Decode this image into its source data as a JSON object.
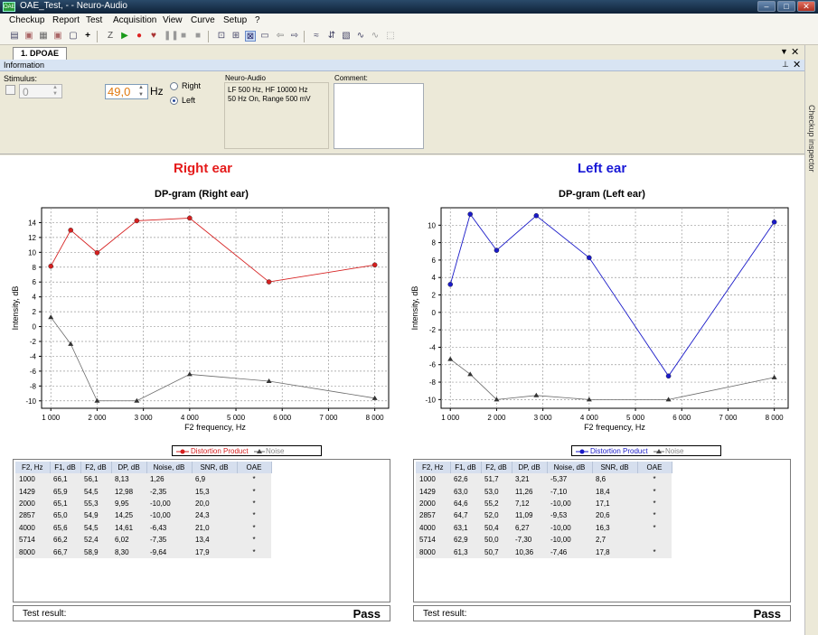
{
  "window": {
    "title": "OAE_Test, - - Neuro-Audio",
    "icon_text": "OAE"
  },
  "menu": [
    "Checkup",
    "Report",
    "Test",
    "Acquisition",
    "View",
    "Curve",
    "Setup",
    "?"
  ],
  "doc_tab": {
    "label": "1. DPOAE"
  },
  "info": {
    "header": "Information",
    "stimulus_label": "Stimulus:",
    "stimulus_value": "0",
    "freq_value": "49,0",
    "freq_unit": "Hz",
    "radio_right": "Right",
    "radio_left": "Left",
    "selected_radio": "Left",
    "device_label": "Neuro-Audio",
    "device_line1": "LF  500 Hz, HF  10000 Hz",
    "device_line2": "50 Hz  On, Range 500 mV",
    "comment_label": "Comment:",
    "comment_value": ""
  },
  "sidebar_label": "Checkup inspector",
  "colors": {
    "right_dp": "#d62020",
    "left_dp": "#1a1ac8",
    "noise": "#6a6a6a",
    "right_title": "#e51b1b",
    "left_title": "#1818d6"
  },
  "right": {
    "ear_title": "Right ear",
    "legend_dp": "Distortion Product",
    "legend_noise": "Noise",
    "result_label": "Test result:",
    "result_value": "Pass",
    "columns": [
      "F2, Hz",
      "F1, dB",
      "F2, dB",
      "DP, dB",
      "Noise, dB",
      "SNR, dB",
      "OAE"
    ],
    "rows": [
      [
        "1000",
        "66,1",
        "56,1",
        "8,13",
        "1,26",
        "6,9",
        "*"
      ],
      [
        "1429",
        "65,9",
        "54,5",
        "12,98",
        "-2,35",
        "15,3",
        "*"
      ],
      [
        "2000",
        "65,1",
        "55,3",
        "9,95",
        "-10,00",
        "20,0",
        "*"
      ],
      [
        "2857",
        "65,0",
        "54,9",
        "14,25",
        "-10,00",
        "24,3",
        "*"
      ],
      [
        "4000",
        "65,6",
        "54,5",
        "14,61",
        "-6,43",
        "21,0",
        "*"
      ],
      [
        "5714",
        "66,2",
        "52,4",
        "6,02",
        "-7,35",
        "13,4",
        "*"
      ],
      [
        "8000",
        "66,7",
        "58,9",
        "8,30",
        "-9,64",
        "17,9",
        "*"
      ]
    ]
  },
  "left": {
    "ear_title": "Left ear",
    "legend_dp": "Distortion Product",
    "legend_noise": "Noise",
    "result_label": "Test result:",
    "result_value": "Pass",
    "columns": [
      "F2, Hz",
      "F1, dB",
      "F2, dB",
      "DP, dB",
      "Noise, dB",
      "SNR, dB",
      "OAE"
    ],
    "rows": [
      [
        "1000",
        "62,6",
        "51,7",
        "3,21",
        "-5,37",
        "8,6",
        "*"
      ],
      [
        "1429",
        "63,0",
        "53,0",
        "11,26",
        "-7,10",
        "18,4",
        "*"
      ],
      [
        "2000",
        "64,6",
        "55,2",
        "7,12",
        "-10,00",
        "17,1",
        "*"
      ],
      [
        "2857",
        "64,7",
        "52,0",
        "11,09",
        "-9,53",
        "20,6",
        "*"
      ],
      [
        "4000",
        "63,1",
        "50,4",
        "6,27",
        "-10,00",
        "16,3",
        "*"
      ],
      [
        "5714",
        "62,9",
        "50,0",
        "-7,30",
        "-10,00",
        "2,7",
        ""
      ],
      [
        "8000",
        "61,3",
        "50,7",
        "10,36",
        "-7,46",
        "17,8",
        "*"
      ]
    ]
  },
  "chart_data": [
    {
      "type": "line",
      "title": "DP-gram (Right ear)",
      "xlabel": "F2 frequency, Hz",
      "ylabel": "Intensity, dB",
      "xlim": [
        800,
        8300
      ],
      "ylim": [
        -11,
        16
      ],
      "xticks": [
        1000,
        2000,
        3000,
        4000,
        5000,
        6000,
        7000,
        8000
      ],
      "xtick_labels": [
        "1 000",
        "2 000",
        "3 000",
        "4 000",
        "5 000",
        "6 000",
        "7 000",
        "8 000"
      ],
      "yticks": [
        -10,
        -8,
        -6,
        -4,
        -2,
        0,
        2,
        4,
        6,
        8,
        10,
        12,
        14
      ],
      "ytick_labels": [
        "-10",
        "-8",
        "-6",
        "-4",
        "-2",
        "0",
        "2",
        "4",
        "6",
        "8",
        "10",
        "12",
        "14"
      ],
      "grid": true,
      "legend": "bottom",
      "series": [
        {
          "name": "Distortion Product",
          "x": [
            1000,
            1429,
            2000,
            2857,
            4000,
            5714,
            8000
          ],
          "y": [
            8.13,
            12.98,
            9.95,
            14.25,
            14.61,
            6.02,
            8.3
          ]
        },
        {
          "name": "Noise",
          "x": [
            1000,
            1429,
            2000,
            2857,
            4000,
            5714,
            8000
          ],
          "y": [
            1.26,
            -2.35,
            -10.0,
            -10.0,
            -6.43,
            -7.35,
            -9.64
          ]
        }
      ]
    },
    {
      "type": "line",
      "title": "DP-gram (Left ear)",
      "xlabel": "F2 frequency, Hz",
      "ylabel": "Intensity, dB",
      "xlim": [
        800,
        8300
      ],
      "ylim": [
        -11,
        12
      ],
      "xticks": [
        1000,
        2000,
        3000,
        4000,
        5000,
        6000,
        7000,
        8000
      ],
      "xtick_labels": [
        "1 000",
        "2 000",
        "3 000",
        "4 000",
        "5 000",
        "6 000",
        "7 000",
        "8 000"
      ],
      "yticks": [
        -10,
        -8,
        -6,
        -4,
        -2,
        0,
        2,
        4,
        6,
        8,
        10
      ],
      "ytick_labels": [
        "-10",
        "-8",
        "-6",
        "-4",
        "-2",
        "0",
        "2",
        "4",
        "6",
        "8",
        "10"
      ],
      "grid": true,
      "legend": "bottom",
      "series": [
        {
          "name": "Distortion Product",
          "x": [
            1000,
            1429,
            2000,
            2857,
            4000,
            5714,
            8000
          ],
          "y": [
            3.21,
            11.26,
            7.12,
            11.09,
            6.27,
            -7.3,
            10.36
          ]
        },
        {
          "name": "Noise",
          "x": [
            1000,
            1429,
            2000,
            2857,
            4000,
            5714,
            8000
          ],
          "y": [
            -5.37,
            -7.1,
            -10.0,
            -9.53,
            -10.0,
            -10.0,
            -7.46
          ]
        }
      ]
    }
  ]
}
